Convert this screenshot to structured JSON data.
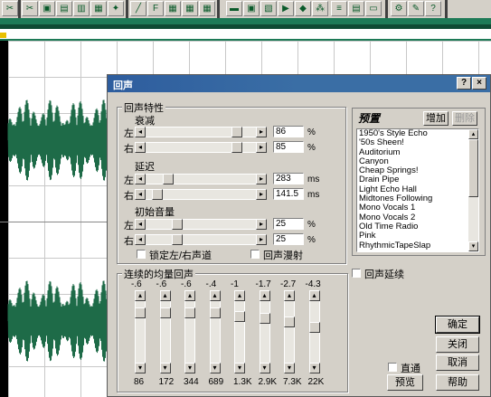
{
  "window": {
    "title": "回声"
  },
  "title_buttons": {
    "help": "?",
    "close": "×"
  },
  "echo_characteristics": {
    "group_label": "回声特性",
    "decay": {
      "label": "衰减",
      "left_label": "左",
      "right_label": "右",
      "left": "86",
      "right": "85",
      "unit": "%"
    },
    "delay": {
      "label": "延迟",
      "left_label": "左",
      "right_label": "右",
      "left": "283",
      "right": "141.5",
      "unit": "ms"
    },
    "initial_volume": {
      "label": "初始音量",
      "left_label": "左",
      "right_label": "右",
      "left": "25",
      "right": "25",
      "unit": "%"
    },
    "lock_lr_label": "锁定左/右声道",
    "echo_bounce_label": "回声漫射"
  },
  "eq": {
    "group_label": "连续的均量回声",
    "gains": [
      "-.6",
      "-.6",
      "-.6",
      "-.4",
      "-1",
      "-1.7",
      "-2.7",
      "-4.3"
    ],
    "frequencies": [
      "86",
      "172",
      "344",
      "689",
      "1.3K",
      "2.9K",
      "7.3K",
      "22K"
    ]
  },
  "presets": {
    "title": "预置",
    "add_label": "增加",
    "delete_label": "删除",
    "items": [
      "1950's Style Echo",
      "'50s Sheen!",
      "Auditorium",
      "Canyon",
      "Cheap Springs!",
      "Drain Pipe",
      "Light Echo Hall",
      "Midtones Following",
      "Mono Vocals 1",
      "Mono Vocals 2",
      "Old Time Radio",
      "Pink",
      "RhythmicTapeSlap"
    ]
  },
  "continue_echo_label": "回声延续",
  "bypass_label": "直通",
  "buttons": {
    "ok": "确定",
    "close": "关闭",
    "cancel": "取消",
    "help": "帮助",
    "preview": "预览"
  },
  "colors": {
    "titlebar": "#3a6ea5",
    "waveform": "#1e6b48",
    "dialog_bg": "#d4d0c8"
  }
}
